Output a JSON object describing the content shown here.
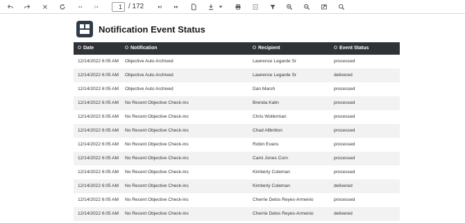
{
  "toolbar": {
    "page_current": "1",
    "page_total": "/ 172",
    "icons": [
      "back-icon",
      "forward-icon",
      "stop-icon",
      "refresh-icon",
      "first-page-icon",
      "previous-page-icon",
      "next-page-icon",
      "last-page-icon",
      "document-icon",
      "download-icon",
      "dropdown-arrow-icon",
      "print-icon",
      "layout-icon",
      "filter-icon",
      "zoom-in-icon",
      "zoom-out-icon",
      "export-icon",
      "search-icon"
    ]
  },
  "report": {
    "title": "Notification Event Status",
    "columns": [
      "Date",
      "Notification",
      "Recipient",
      "Event Status"
    ],
    "rows": [
      {
        "date": "12/14/2022 6:05 AM",
        "notification": "Objective Auto Archived",
        "recipient": "Lawrence Legarde Sr",
        "status": "processed"
      },
      {
        "date": "12/14/2022 6:05 AM",
        "notification": "Objective Auto Archived",
        "recipient": "Lawrence Legarde Sr",
        "status": "delivered"
      },
      {
        "date": "12/14/2022 6:05 AM",
        "notification": "Objective Auto Archived",
        "recipient": "Dan Marsh",
        "status": "processed"
      },
      {
        "date": "12/14/2022 6:05 AM",
        "notification": "No Recent Objective Check-ins",
        "recipient": "Brenda Kalin",
        "status": "processed"
      },
      {
        "date": "12/14/2022 6:05 AM",
        "notification": "No Recent Objective Check-ins",
        "recipient": "Chris Wollerman",
        "status": "processed"
      },
      {
        "date": "12/14/2022 6:05 AM",
        "notification": "No Recent Objective Check-ins",
        "recipient": "Chad Allbritton",
        "status": "processed"
      },
      {
        "date": "12/14/2022 6:05 AM",
        "notification": "No Recent Objective Check-ins",
        "recipient": "Robin Evans",
        "status": "processed"
      },
      {
        "date": "12/14/2022 6:05 AM",
        "notification": "No Recent Objective Check-ins",
        "recipient": "Cami Jones Corn",
        "status": "processed"
      },
      {
        "date": "12/14/2022 6:05 AM",
        "notification": "No Recent Objective Check-ins",
        "recipient": "Kimberly Coleman",
        "status": "processed"
      },
      {
        "date": "12/14/2022 6:05 AM",
        "notification": "No Recent Objective Check-ins",
        "recipient": "Kimberly Coleman",
        "status": "delivered"
      },
      {
        "date": "12/14/2022 6:05 AM",
        "notification": "No Recent Objective Check-ins",
        "recipient": "Cherrie Delos Reyes-Armenio",
        "status": "processed"
      },
      {
        "date": "12/14/2022 6:05 AM",
        "notification": "No Recent Objective Check-ins",
        "recipient": "Cherrie Delos Reyes-Armenio",
        "status": "delivered"
      }
    ]
  },
  "colors": {
    "header_bg": "#2f3237",
    "logo_bg": "#2f3b4a",
    "row_alt": "#f2f2f2"
  }
}
